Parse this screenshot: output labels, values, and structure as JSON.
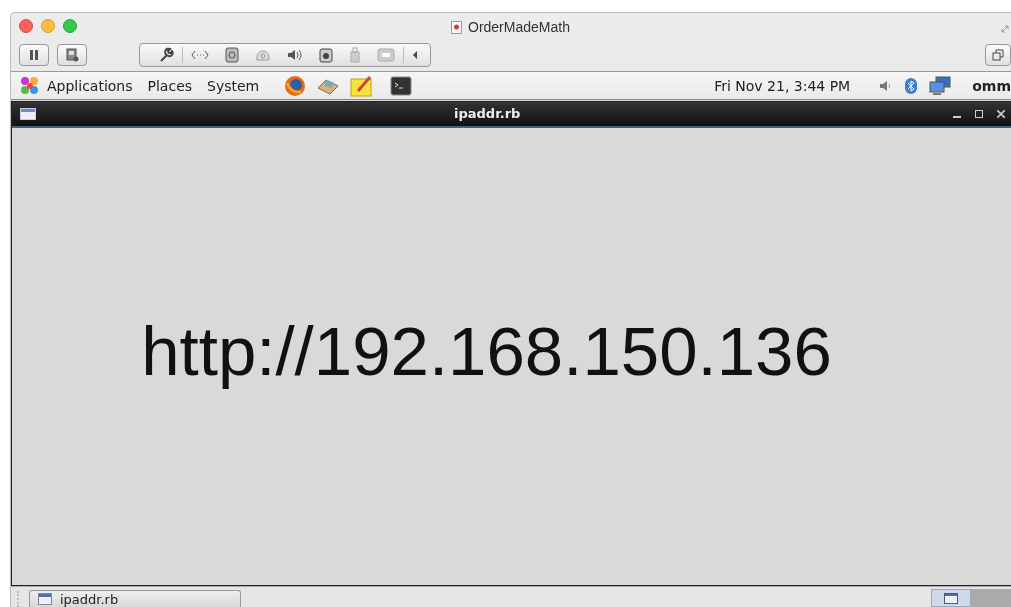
{
  "host_window": {
    "title": "OrderMadeMath"
  },
  "panel": {
    "menus": [
      "Applications",
      "Places",
      "System"
    ],
    "clock": "Fri Nov 21,  3:44 PM",
    "user": "omm"
  },
  "app_window": {
    "title": "ipaddr.rb",
    "content": "http://192.168.150.136"
  },
  "taskbar": {
    "tasks": [
      {
        "label": "ipaddr.rb",
        "selected": false
      }
    ],
    "workspaces": [
      {
        "selected": true
      },
      {
        "selected": false
      }
    ]
  }
}
